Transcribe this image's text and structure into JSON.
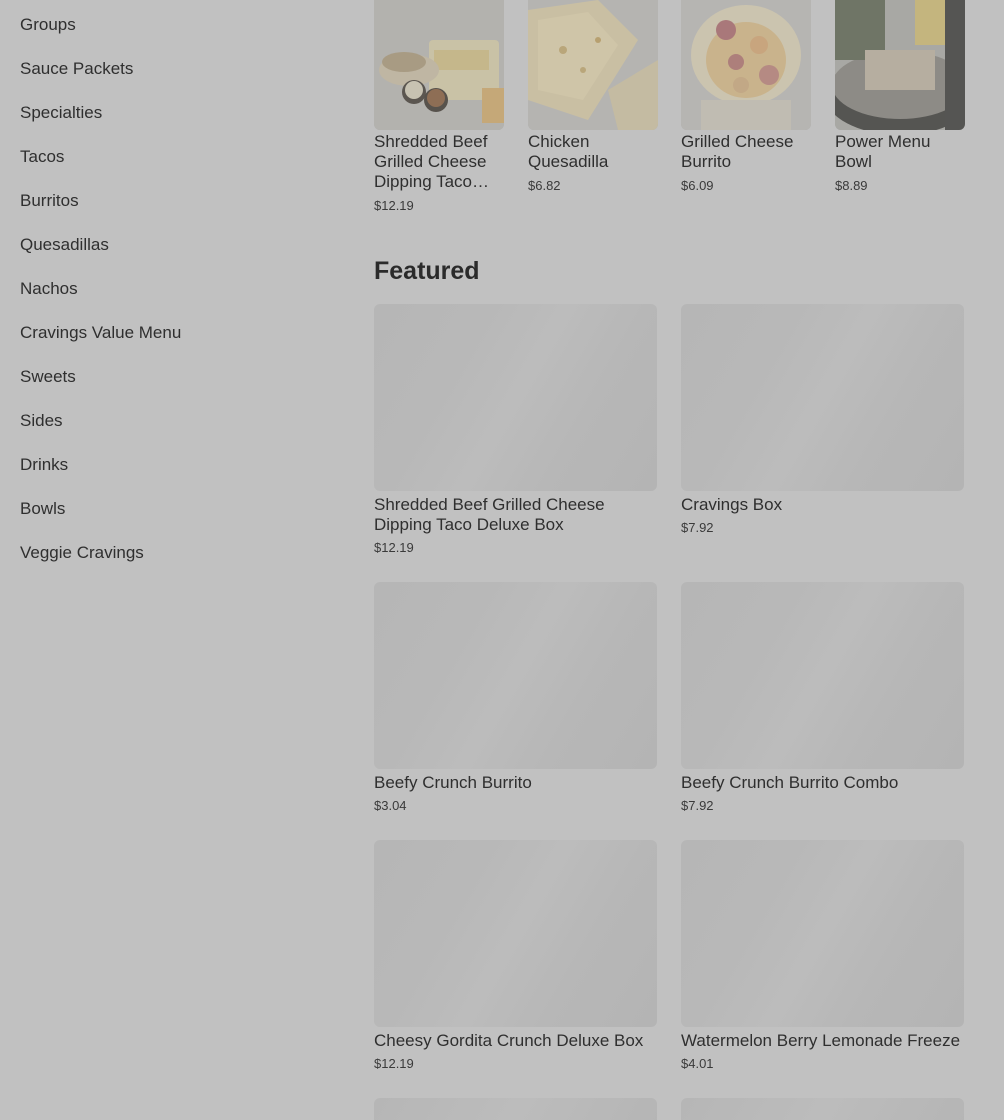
{
  "sidebar": {
    "items": [
      {
        "label": "Groups"
      },
      {
        "label": "Sauce Packets"
      },
      {
        "label": "Specialties"
      },
      {
        "label": "Tacos"
      },
      {
        "label": "Burritos"
      },
      {
        "label": "Quesadillas"
      },
      {
        "label": "Nachos"
      },
      {
        "label": "Cravings Value Menu"
      },
      {
        "label": "Sweets"
      },
      {
        "label": "Sides"
      },
      {
        "label": "Drinks"
      },
      {
        "label": "Bowls"
      },
      {
        "label": "Veggie Cravings"
      }
    ]
  },
  "carousel": {
    "items": [
      {
        "name": "Shredded Beef Grilled Cheese Dipping Taco Deluxe Box",
        "price": "$12.19",
        "image": "shredded-beef-box-photo"
      },
      {
        "name": "Chicken Quesadilla",
        "price": "$6.82",
        "image": "chicken-quesadilla-photo"
      },
      {
        "name": "Grilled Cheese Burrito",
        "price": "$6.09",
        "image": "grilled-cheese-burrito-photo"
      },
      {
        "name": "Power Menu Bowl",
        "price": "$8.89",
        "image": "power-menu-bowl-photo"
      }
    ]
  },
  "featured": {
    "title": "Featured",
    "items": [
      {
        "name": "Shredded Beef Grilled Cheese Dipping Taco Deluxe Box",
        "price": "$12.19"
      },
      {
        "name": "Cravings Box",
        "price": "$7.92"
      },
      {
        "name": "Beefy Crunch Burrito",
        "price": "$3.04"
      },
      {
        "name": "Beefy Crunch Burrito Combo",
        "price": "$7.92"
      },
      {
        "name": "Cheesy Gordita Crunch Deluxe Box",
        "price": "$12.19"
      },
      {
        "name": "Watermelon Berry Lemonade Freeze",
        "price": "$4.01"
      }
    ]
  },
  "colors": {
    "overlay_background": "#c1c1c1",
    "text": "#2f2f2f",
    "placeholder_image": "#b8b8b8"
  }
}
